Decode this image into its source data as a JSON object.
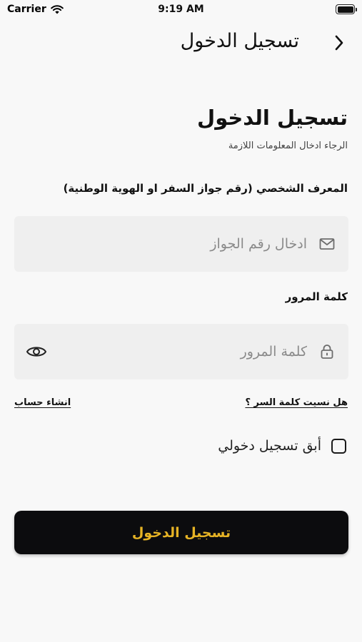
{
  "status_bar": {
    "carrier": "Carrier",
    "time": "9:19 AM"
  },
  "nav": {
    "title": "تسجيل الدخول",
    "back_icon": "chevron-right-icon"
  },
  "form": {
    "heading": "تسجيل الدخول",
    "subheading": "الرجاء ادخال المعلومات اللازمة",
    "id_label": "المعرف الشخصي (رقم جواز السفر او الهوية الوطنية)",
    "id_placeholder": "ادخال رقم الجواز",
    "id_value": "",
    "password_label": "كلمة المرور",
    "password_placeholder": "كلمة المرور",
    "password_value": "",
    "forgot_password": "هل نسيت كلمة السر ؟",
    "create_account": "انشاء حساب",
    "remember_me": "أبق تسجيل دخولي",
    "remember_checked": false,
    "login_button": "تسجيل الدخول"
  },
  "icons": {
    "id_field": "envelope-icon",
    "password_field": "lock-icon",
    "toggle_visibility": "eye-icon"
  },
  "colors": {
    "background": "#f8f8f8",
    "field_background": "#efefef",
    "button_background": "#0c0c0e",
    "button_text": "#e6b325"
  }
}
